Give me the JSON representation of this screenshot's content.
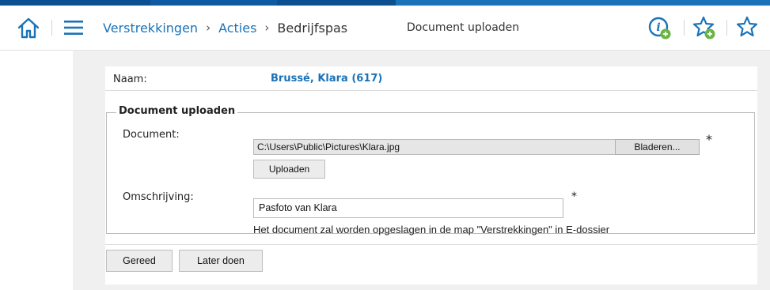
{
  "colors": {
    "strip": [
      "#0b4f91",
      "#0b4f91",
      "#0e6bbd",
      "#0b4f91",
      "#1a73b8"
    ],
    "link": "#1a73b8",
    "icon_blue": "#1a73b8",
    "icon_green": "#6ab443"
  },
  "header": {
    "breadcrumb": [
      {
        "label": "Verstrekkingen"
      },
      {
        "label": "Acties"
      },
      {
        "label": "Bedrijfspas"
      }
    ],
    "crumb_separator": "›",
    "page_title": "Document uploaden",
    "icons": [
      "home-icon",
      "menu-icon",
      "info-add-icon",
      "favorite-add-icon",
      "favorite-icon"
    ]
  },
  "employee": {
    "label": "Naam:",
    "value": "Brussé, Klara (617)"
  },
  "form": {
    "legend": "Document uploaden",
    "document_label": "Document:",
    "document_value": "C:\\Users\\Public\\Pictures\\Klara.jpg",
    "browse_label": "Bladeren...",
    "upload_label": "Uploaden",
    "description_label": "Omschrijving:",
    "description_value": "Pasfoto van Klara",
    "required_mark": "*",
    "hint": "Het document zal worden opgeslagen in de map \"Verstrekkingen\" in E-dossier"
  },
  "actions": {
    "done_label": "Gereed",
    "later_label": "Later doen"
  }
}
